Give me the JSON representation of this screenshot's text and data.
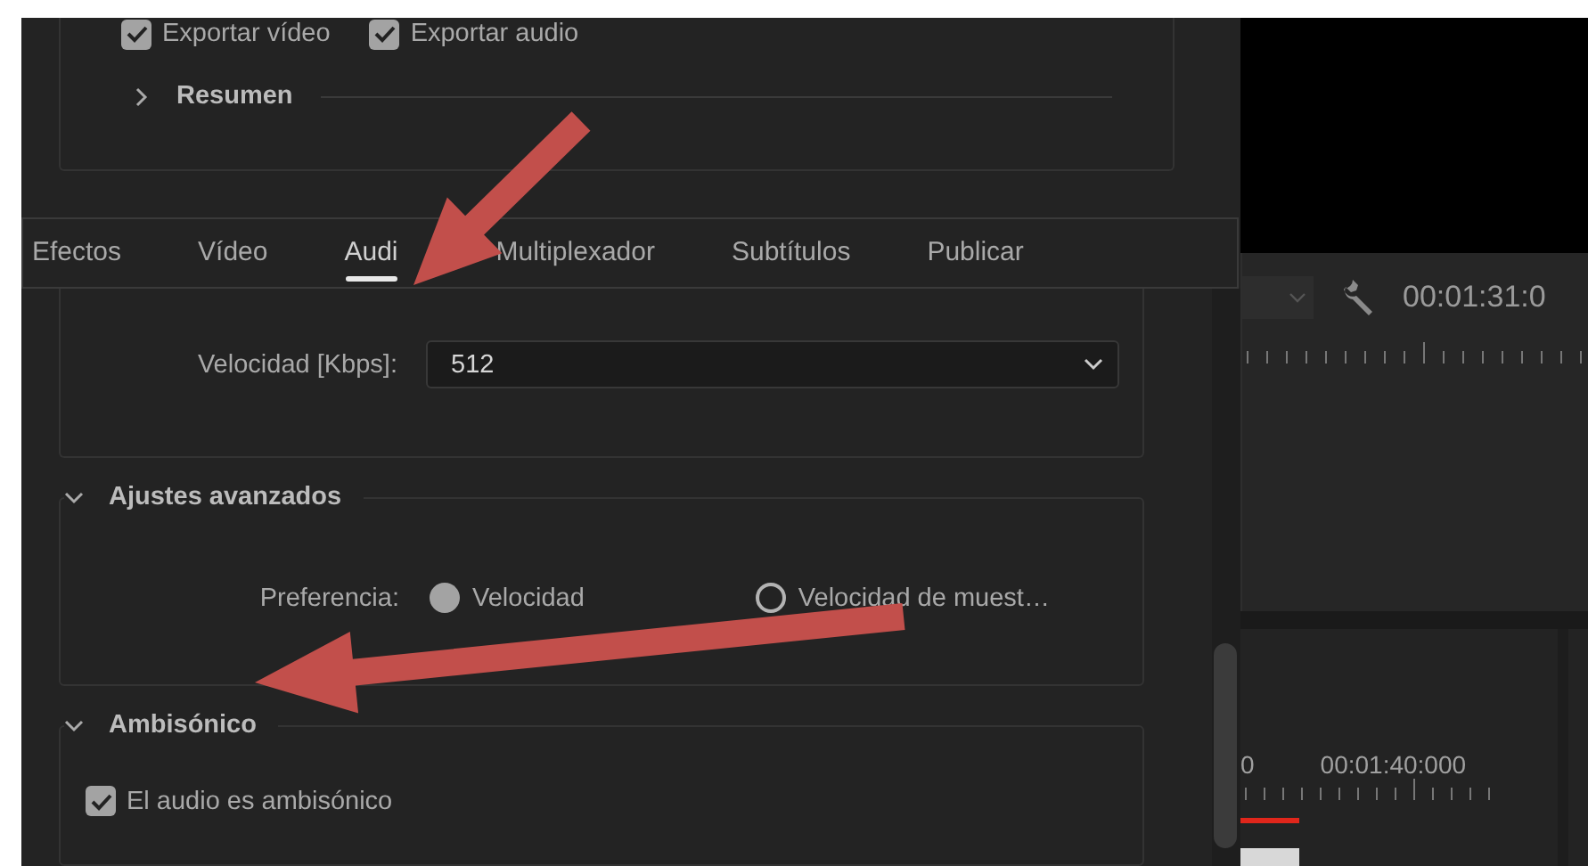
{
  "export_options": {
    "checkboxes": [
      {
        "label": "Exportar vídeo",
        "checked": true
      },
      {
        "label": "Exportar audio",
        "checked": true
      }
    ],
    "summary": {
      "title": "Resumen",
      "expanded": false
    }
  },
  "tabs": [
    {
      "label": "Efectos",
      "selected": false
    },
    {
      "label": "Vídeo",
      "selected": false
    },
    {
      "label": "Audi",
      "selected": true
    },
    {
      "label": "Multiplexador",
      "selected": false
    },
    {
      "label": "Subtítulos",
      "selected": false
    },
    {
      "label": "Publicar",
      "selected": false
    }
  ],
  "audio_bitrate": {
    "label": "Velocidad [Kbps]:",
    "value": "512"
  },
  "advanced": {
    "title": "Ajustes avanzados",
    "expanded": true,
    "preference_label": "Preferencia:",
    "options": [
      {
        "label": "Velocidad",
        "selected": true
      },
      {
        "label": "Velocidad de muest…",
        "selected": false
      }
    ]
  },
  "ambisonic": {
    "title": "Ambisónico",
    "expanded": true,
    "checkbox": {
      "label": "El audio es ambisónico",
      "checked": true
    }
  },
  "monitor": {
    "timecode": "00:01:31:0"
  },
  "timeline": {
    "ruler_labels": [
      "0",
      "00:01:40:000"
    ]
  }
}
